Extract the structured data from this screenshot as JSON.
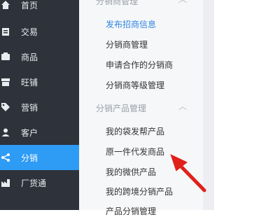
{
  "nav": {
    "items": [
      {
        "label": "首页",
        "icon": "home-icon"
      },
      {
        "label": "交易",
        "icon": "clipboard-icon"
      },
      {
        "label": "商品",
        "icon": "box-icon"
      },
      {
        "label": "旺铺",
        "icon": "store-icon"
      },
      {
        "label": "营销",
        "icon": "tag-icon"
      },
      {
        "label": "客户",
        "icon": "user-icon"
      },
      {
        "label": "分销",
        "icon": "share-icon",
        "active": true
      },
      {
        "label": "厂货通",
        "icon": "factory-icon"
      }
    ]
  },
  "submenu": {
    "group1": {
      "label": "分销商管理"
    },
    "group1_items": [
      {
        "label": "发布招商信息",
        "selected": true
      },
      {
        "label": "分销商管理"
      },
      {
        "label": "申请合作的分销商"
      },
      {
        "label": "分销商等级管理"
      }
    ],
    "group2": {
      "label": "分销产品管理"
    },
    "group2_items": [
      {
        "label": "我的袋发帮产品"
      },
      {
        "label": "原一件代发商品"
      },
      {
        "label": "我的微供产品"
      },
      {
        "label": "我的跨境分销产品"
      },
      {
        "label": "产品分销管理"
      }
    ]
  },
  "colors": {
    "nav_bg": "#2e323b",
    "active_bg": "#2e9bf5",
    "selected_text": "#2e86e0",
    "arrow": "#e0201a"
  }
}
